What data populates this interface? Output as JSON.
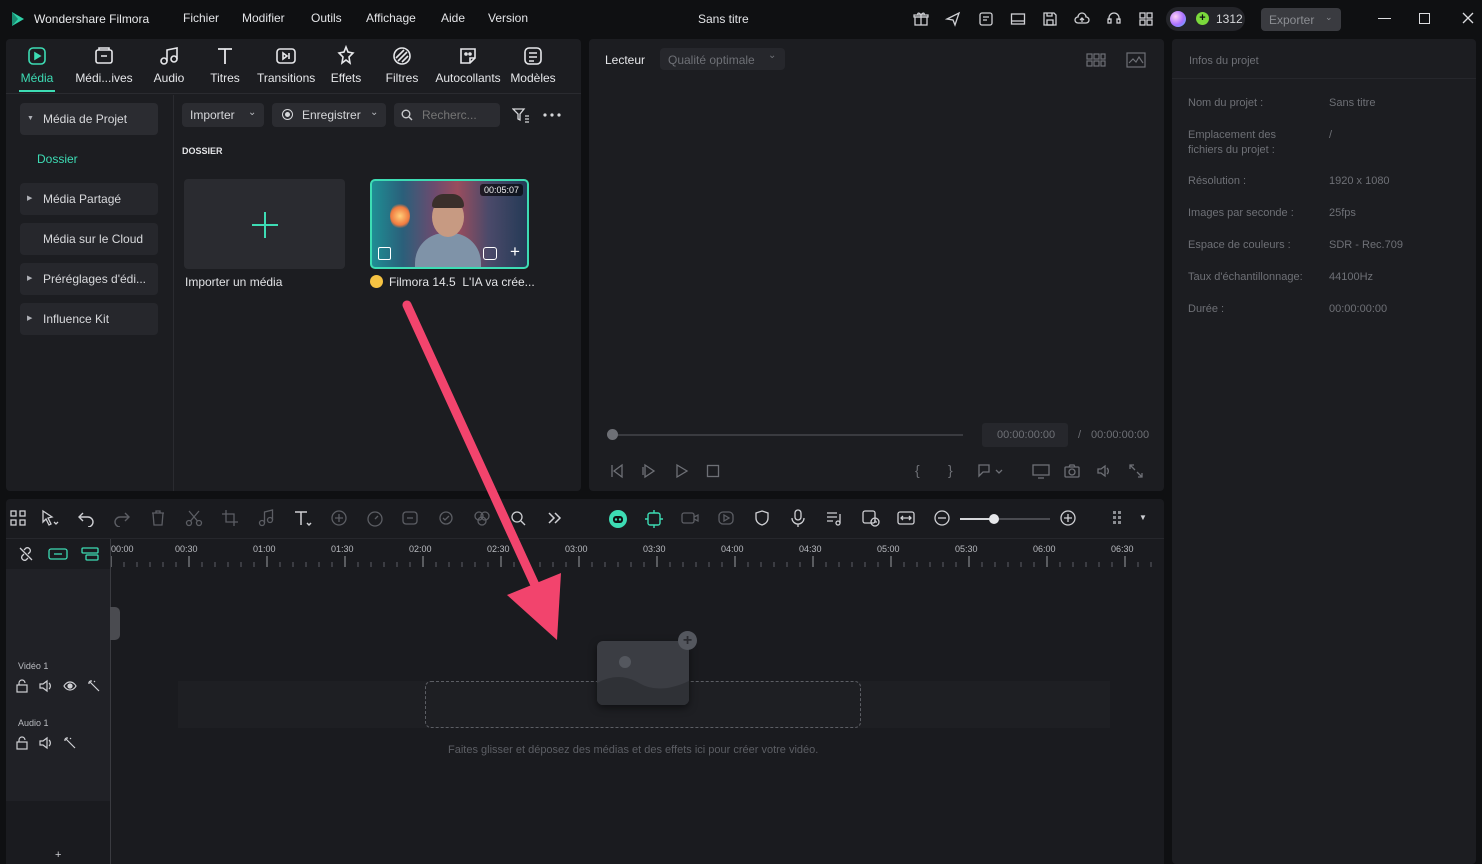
{
  "app": {
    "name": "Wondershare Filmora",
    "doc_title": "Sans titre"
  },
  "menu": [
    "Fichier",
    "Modifier",
    "Outils",
    "Affichage",
    "Aide",
    "Version"
  ],
  "header": {
    "credits": "1312",
    "export_label": "Exporter"
  },
  "tools": [
    {
      "label": "Média",
      "icon": "media-icon",
      "active": true
    },
    {
      "label": "Médi...ives",
      "icon": "stock-media-icon"
    },
    {
      "label": "Audio",
      "icon": "audio-icon"
    },
    {
      "label": "Titres",
      "icon": "titles-icon"
    },
    {
      "label": "Transitions",
      "icon": "transitions-icon"
    },
    {
      "label": "Effets",
      "icon": "effects-icon"
    },
    {
      "label": "Filtres",
      "icon": "filters-icon"
    },
    {
      "label": "Autocollants",
      "icon": "stickers-icon"
    },
    {
      "label": "Modèles",
      "icon": "templates-icon"
    }
  ],
  "sidebar": {
    "items": [
      {
        "label": "Média de Projet"
      },
      {
        "label": "Dossier"
      },
      {
        "label": "Média Partagé"
      },
      {
        "label": "Média sur le Cloud"
      },
      {
        "label": "Préréglages d'édi..."
      },
      {
        "label": "Influence Kit"
      }
    ]
  },
  "media": {
    "import_label": "Importer",
    "record_label": "Enregistrer",
    "search_placeholder": "Recherc...",
    "folder_label": "DOSSIER",
    "import_tile_label": "Importer un média",
    "clip": {
      "title": "Filmora 14.5  L'IA va crée...",
      "duration": "00:05:07"
    }
  },
  "player": {
    "tab": "Lecteur",
    "quality": "Qualité optimale",
    "current_time": "00:00:00:00",
    "separator": "/",
    "total_time": "00:00:00:00"
  },
  "project_info": {
    "title": "Infos du projet",
    "rows": [
      {
        "label": "Nom du projet :",
        "value": "Sans titre"
      },
      {
        "label": "Emplacement des fichiers du projet :",
        "value": "/"
      },
      {
        "label": "Résolution :",
        "value": "1920 x 1080"
      },
      {
        "label": "Images par seconde :",
        "value": "25fps"
      },
      {
        "label": "Espace de couleurs :",
        "value": "SDR - Rec.709"
      },
      {
        "label": "Taux d'échantillonnage:",
        "value": "44100Hz"
      },
      {
        "label": "Durée :",
        "value": "00:00:00:00"
      }
    ]
  },
  "timeline": {
    "ruler": [
      "00:00",
      "00:30",
      "01:00",
      "01:30",
      "02:00",
      "02:30",
      "03:00",
      "03:30",
      "04:00",
      "04:30",
      "05:00",
      "05:30",
      "06:00",
      "06:30"
    ],
    "zoom_level": 0.38,
    "tracks": [
      {
        "label": "Vidéo 1"
      },
      {
        "label": "Audio 1"
      }
    ],
    "drop_hint": "Faites glisser et déposez des médias et des effets ici pour créer votre vidéo.",
    "add_track": "+"
  },
  "colors": {
    "accent": "#3ddcb4",
    "arrow": "#f2446d",
    "panel": "#1c1d21",
    "background": "#0f1012"
  }
}
